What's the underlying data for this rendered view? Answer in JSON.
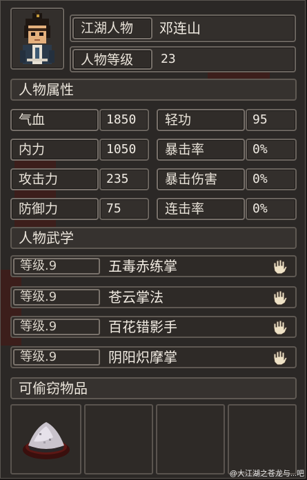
{
  "character": {
    "name_label": "江湖人物",
    "name": "邓连山",
    "level_label": "人物等级",
    "level": "23"
  },
  "attributes": {
    "title": "人物属性",
    "rows": [
      {
        "left_label": "气血",
        "left_value": "1850",
        "right_label": "轻功",
        "right_value": "95"
      },
      {
        "left_label": "内力",
        "left_value": "1050",
        "right_label": "暴击率",
        "right_value": "0%"
      },
      {
        "left_label": "攻击力",
        "left_value": "235",
        "right_label": "暴击伤害",
        "right_value": "0%"
      },
      {
        "left_label": "防御力",
        "left_value": "75",
        "right_label": "连击率",
        "right_value": "0%"
      }
    ]
  },
  "martial": {
    "title": "人物武学",
    "skills": [
      {
        "level": "等级.9",
        "name": "五毒赤练掌",
        "icon": "palm-icon"
      },
      {
        "level": "等级.9",
        "name": "苍云掌法",
        "icon": "palm-icon"
      },
      {
        "level": "等级.9",
        "name": "百花错影手",
        "icon": "palm-icon"
      },
      {
        "level": "等级.9",
        "name": "阴阳炽摩掌",
        "icon": "palm-icon"
      }
    ]
  },
  "steal": {
    "title": "可偷窃物品",
    "slots": [
      {
        "item": "powder-pile-icon"
      },
      {
        "item": ""
      },
      {
        "item": ""
      },
      {
        "item": ""
      }
    ]
  },
  "watermark": "@大江湖之苍龙与...吧"
}
